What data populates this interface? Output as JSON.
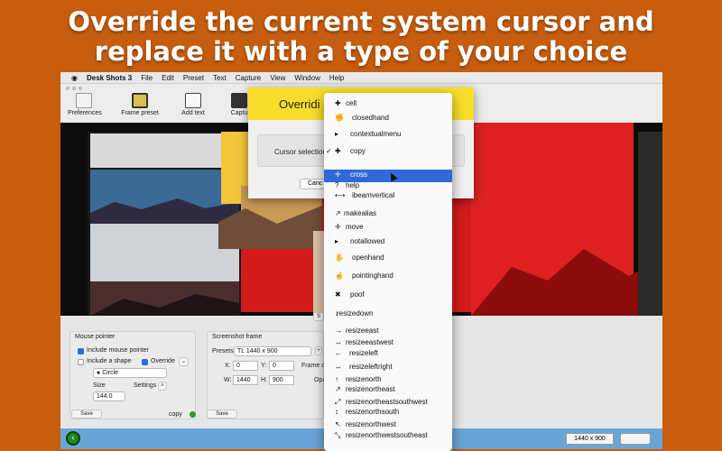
{
  "headline": {
    "line1": "Override the current system cursor and",
    "line2": "replace it with a type of your choice"
  },
  "menubar": {
    "apple": "",
    "items": [
      "Desk Shots 3",
      "File",
      "Edit",
      "Preset",
      "Text",
      "Capture",
      "View",
      "Window",
      "Help"
    ]
  },
  "toolbar": {
    "preferences": "Preferences",
    "frame_preset": "Frame preset",
    "add_text": "Add text",
    "capture": "Captu"
  },
  "modal": {
    "title": "Overridi",
    "cursor_selection_label": "Cursor selection",
    "cancel": "Canc"
  },
  "mouse_pointer": {
    "title": "Mouse pointer",
    "include_mouse_pointer": "Include mouse pointer",
    "include_shape": "Include a shape",
    "override": "Override",
    "shape": "Circle",
    "size_label": "Size",
    "size_value": "144.0",
    "settings_label": "Settings",
    "save": "Save",
    "copy": "copy"
  },
  "screenshot_frame": {
    "title": "Screenshot frame",
    "presets_label": "Presets:",
    "preset_value": "TL 1440 x 900",
    "x_label": "X:",
    "x_value": "0",
    "y_label": "Y:",
    "y_value": "0",
    "w_label": "W:",
    "w_value": "1440",
    "h_label": "H:",
    "h_value": "900",
    "frame_co": "Frame co",
    "opa": "Opa",
    "save": "Save",
    "s_tab": "S"
  },
  "status": {
    "resolution": "1440 x 900"
  },
  "cursor_menu": {
    "items": [
      "cell",
      "closedhand",
      "contextualmenu",
      "copy",
      "cross",
      "help",
      "ibeamvertical",
      "makealias",
      "move",
      "notallowed",
      "openhand",
      "pointinghand",
      "poof",
      "resizedown",
      "resizeeast",
      "resizeeastwest",
      "resizeleft",
      "resizeleftright",
      "resizenorth",
      "resizenortheast",
      "resizenortheastsouthwest",
      "resizenorthsouth",
      "resizenorthwest",
      "resizenorthwestsoutheast"
    ],
    "checked": "copy",
    "selected": "cross"
  },
  "colors": {
    "background": "#c65d0f",
    "accent": "#2f6ad8",
    "modal_header": "#f8de2a",
    "desktop_red": "#c81818"
  }
}
